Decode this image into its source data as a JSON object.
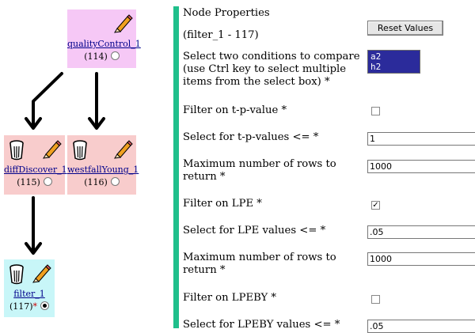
{
  "workflow": {
    "nodes": [
      {
        "name": "qualityControl_1",
        "id": "(114)",
        "selected": false,
        "required": false
      },
      {
        "name": "diffDiscover_1",
        "id": "(115)",
        "selected": false,
        "required": false
      },
      {
        "name": "westfallYoung_1",
        "id": "(116)",
        "selected": false,
        "required": false
      },
      {
        "name": "filter_1",
        "id": "(117)",
        "selected": true,
        "required": true,
        "marker": "*"
      }
    ]
  },
  "panel": {
    "title": "Node Properties",
    "subtitle": "(filter_1 - 117)",
    "reset_label": "Reset Values",
    "fields": {
      "compare": {
        "label_lines": [
          "Select two conditions to compare",
          "(use Ctrl key to select multiple",
          "items from the select box) *"
        ],
        "options": [
          "a2",
          "h2"
        ]
      },
      "filter_tp": {
        "label": "Filter on t-p-value *",
        "checked": false
      },
      "tp_values": {
        "label": "Select for t-p-values <= *",
        "value": "1"
      },
      "max_rows_1": {
        "label_lines": [
          "Maximum number of rows to",
          "return *"
        ],
        "value": "1000"
      },
      "filter_lpe": {
        "label": "Filter on LPE *",
        "checked": true,
        "check_glyph": "✓"
      },
      "lpe_values": {
        "label": "Select for LPE values <= *",
        "value": ".05"
      },
      "max_rows_2": {
        "label_lines": [
          "Maximum number of rows to",
          "return *"
        ],
        "value": "1000"
      },
      "filter_lpeby": {
        "label": "Filter on LPEBY *",
        "checked": false
      },
      "lpeby_values": {
        "label": "Select for LPEBY values <= *",
        "value": ".05"
      }
    }
  },
  "colors": {
    "divider": "#1fbf8b",
    "node_quality": "#f6c8f6",
    "node_diff": "#f8cccc",
    "node_filter": "#c8f6f8",
    "select_bg": "#2b2b9b"
  }
}
